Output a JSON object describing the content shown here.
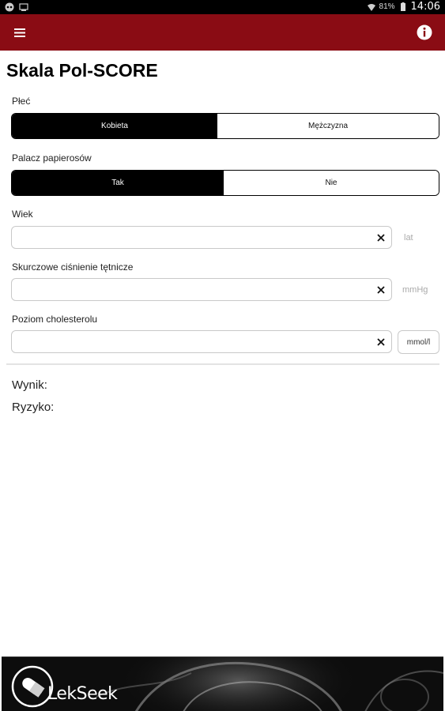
{
  "status_bar": {
    "battery_percent": "81%",
    "time": "14:06",
    "icons": [
      "media-icon",
      "cast-icon",
      "wifi-icon",
      "battery-icon"
    ]
  },
  "app_bar": {
    "color": "#8a0c14",
    "menu_icon": "hamburger-icon",
    "info_icon": "info-icon"
  },
  "page": {
    "title": "Skala Pol-SCORE"
  },
  "form": {
    "sex": {
      "label": "Płeć",
      "options": [
        "Kobieta",
        "Mężczyzna"
      ],
      "selected": "Kobieta"
    },
    "smoker": {
      "label": "Palacz papierosów",
      "options": [
        "Tak",
        "Nie"
      ],
      "selected": "Tak"
    },
    "age": {
      "label": "Wiek",
      "value": "",
      "unit": "lat"
    },
    "pressure": {
      "label": "Skurczowe ciśnienie tętnicze",
      "value": "",
      "unit": "mmHg"
    },
    "cholesterol": {
      "label": "Poziom cholesterolu",
      "value": "",
      "unit": "mmol/l"
    }
  },
  "results": {
    "score_label": "Wynik:",
    "risk_label": "Ryzyko:"
  },
  "footer": {
    "brand": "LekSeek"
  }
}
